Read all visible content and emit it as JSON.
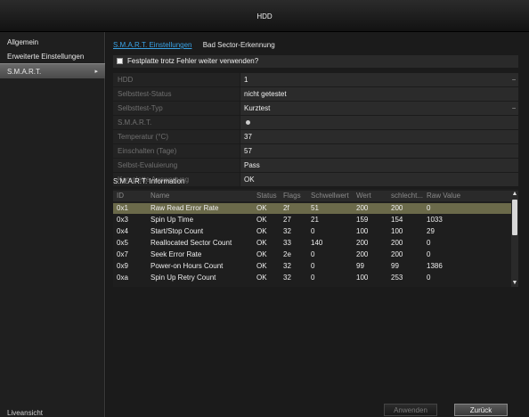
{
  "window": {
    "title": "HDD"
  },
  "sidebar": {
    "items": [
      {
        "label": "Allgemein"
      },
      {
        "label": "Erweiterte Einstellungen"
      },
      {
        "label": "S.M.A.R.T."
      }
    ],
    "live_label": "Liveansicht"
  },
  "tabs": [
    {
      "label": "S.M.A.R.T. Einstellungen"
    },
    {
      "label": "Bad Sector-Erkennung"
    }
  ],
  "checkbox": {
    "label": "Festplatte trotz Fehler weiter verwenden?",
    "checked": false
  },
  "info": [
    {
      "label": "HDD",
      "value": "1",
      "dropdown": true
    },
    {
      "label": "Selbsttest-Status",
      "value": "nicht getestet"
    },
    {
      "label": "Selbsttest-Typ",
      "value": "Kurztest",
      "dropdown": true
    },
    {
      "label": "S.M.A.R.T.",
      "value": ""
    },
    {
      "label": "Temperatur (°C)",
      "value": "37"
    },
    {
      "label": "Einschalten (Tage)",
      "value": "57"
    },
    {
      "label": "Selbst-Evaluierung",
      "value": "Pass"
    },
    {
      "label": "Komplette Auswertung",
      "value": "OK"
    }
  ],
  "smart_title": "S.M.A.R.T. Information",
  "table": {
    "headers": [
      "ID",
      "Name",
      "Status",
      "Flags",
      "Schwellwert",
      "Wert",
      "schlecht...",
      "Raw Value"
    ],
    "rows": [
      [
        "0x1",
        "Raw Read Error Rate",
        "OK",
        "2f",
        "51",
        "200",
        "200",
        "0"
      ],
      [
        "0x3",
        "Spin Up Time",
        "OK",
        "27",
        "21",
        "159",
        "154",
        "1033"
      ],
      [
        "0x4",
        "Start/Stop Count",
        "OK",
        "32",
        "0",
        "100",
        "100",
        "29"
      ],
      [
        "0x5",
        "Reallocated Sector Count",
        "OK",
        "33",
        "140",
        "200",
        "200",
        "0"
      ],
      [
        "0x7",
        "Seek Error Rate",
        "OK",
        "2e",
        "0",
        "200",
        "200",
        "0"
      ],
      [
        "0x9",
        "Power-on Hours Count",
        "OK",
        "32",
        "0",
        "99",
        "99",
        "1386"
      ],
      [
        "0xa",
        "Spin Up Retry Count",
        "OK",
        "32",
        "0",
        "100",
        "253",
        "0"
      ]
    ],
    "selected_row": 0
  },
  "buttons": {
    "apply": "Anwenden",
    "back": "Zurück"
  }
}
